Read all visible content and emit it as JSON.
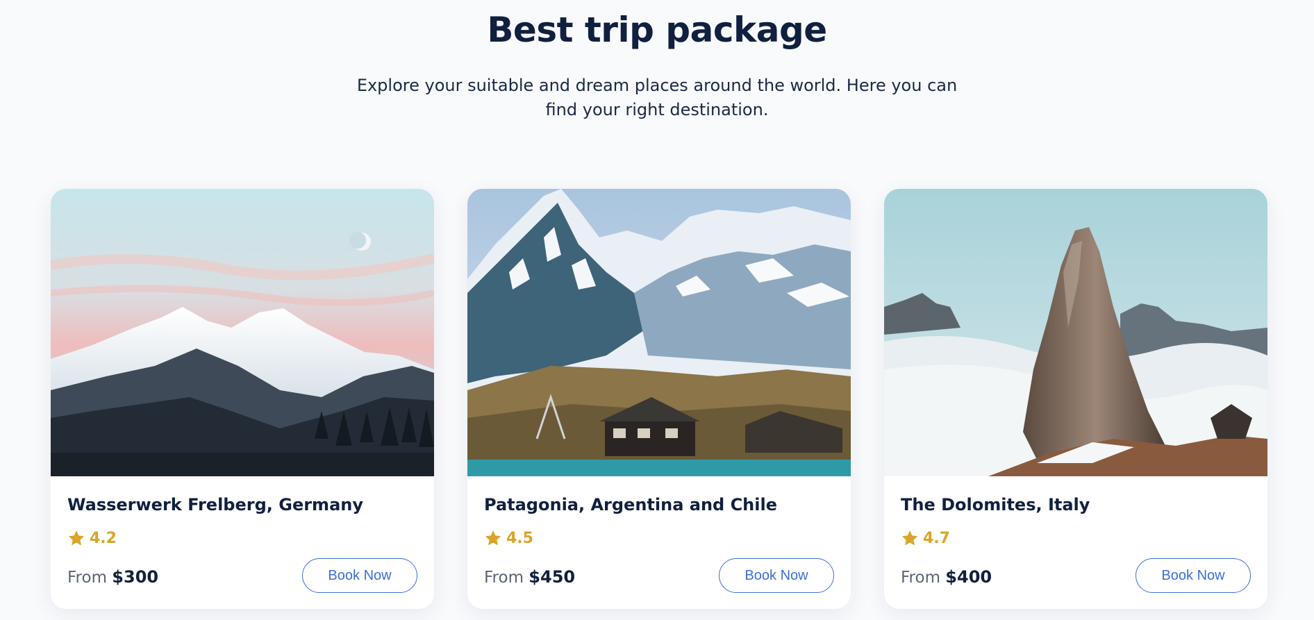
{
  "section": {
    "title": "Best trip package",
    "subtitle": "Explore your suitable and dream places around the world. Here you can find your right destination."
  },
  "packages": [
    {
      "name": "Wasserwerk Frelberg, Germany",
      "rating": "4.2",
      "price_prefix": "From",
      "price": "$300",
      "button_label": "Book Now",
      "image_icon": "snowy-mountain-sunset-photo"
    },
    {
      "name": "Patagonia, Argentina and Chile",
      "rating": "4.5",
      "price_prefix": "From",
      "price": "$450",
      "button_label": "Book Now",
      "image_icon": "alpine-mountain-chalet-photo"
    },
    {
      "name": "The Dolomites, Italy",
      "rating": "4.7",
      "price_prefix": "From",
      "price": "$400",
      "button_label": "Book Now",
      "image_icon": "rock-peak-above-clouds-photo"
    }
  ],
  "colors": {
    "accent": "#3a6fd8",
    "rating_star": "#d9a52a",
    "heading": "#10203f"
  }
}
